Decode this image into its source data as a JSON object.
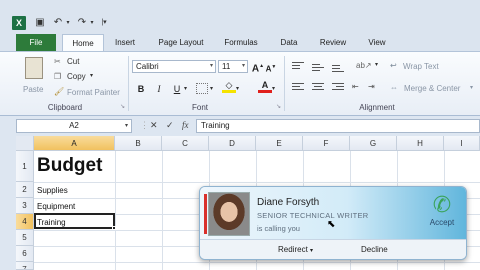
{
  "qat": {
    "app_icon": "X",
    "save_icon": "floppy-disk",
    "undo_icon": "undo-arrow",
    "redo_icon": "redo-arrow",
    "customize_icon": "dropdown-caret"
  },
  "tabs": {
    "file": "File",
    "home": "Home",
    "insert": "Insert",
    "page_layout": "Page Layout",
    "formulas": "Formulas",
    "data": "Data",
    "review": "Review",
    "view": "View"
  },
  "clipboard": {
    "paste": "Paste",
    "cut": "Cut",
    "copy": "Copy",
    "format_painter": "Format Painter",
    "group": "Clipboard"
  },
  "font": {
    "name": "Calibri",
    "size": "11",
    "group": "Font",
    "bold": "B",
    "italic": "I",
    "underline": "U",
    "grow": "A",
    "shrink": "A",
    "color_letter": "A"
  },
  "alignment": {
    "wrap_text": "Wrap Text",
    "merge_center": "Merge & Center",
    "group": "Alignment"
  },
  "formula_bar": {
    "name_box": "A2",
    "content": "Training",
    "fx": "fx"
  },
  "columns": [
    "A",
    "B",
    "C",
    "D",
    "E",
    "F",
    "G",
    "H",
    "I"
  ],
  "rows": [
    "1",
    "2",
    "3",
    "4",
    "5",
    "6",
    "7"
  ],
  "cells": {
    "a1": "Budget",
    "a2": "Supplies",
    "a3": "Equipment",
    "a4": "Training"
  },
  "call": {
    "name": "Diane Forsyth",
    "title": "SENIOR TECHNICAL WRITER",
    "status": "is calling you",
    "accept": "Accept",
    "redirect": "Redirect",
    "decline": "Decline"
  },
  "colors": {
    "file_tab": "#2d7b3a",
    "selection_header": "#f1c15f",
    "accept_phone": "#3aa35a"
  }
}
